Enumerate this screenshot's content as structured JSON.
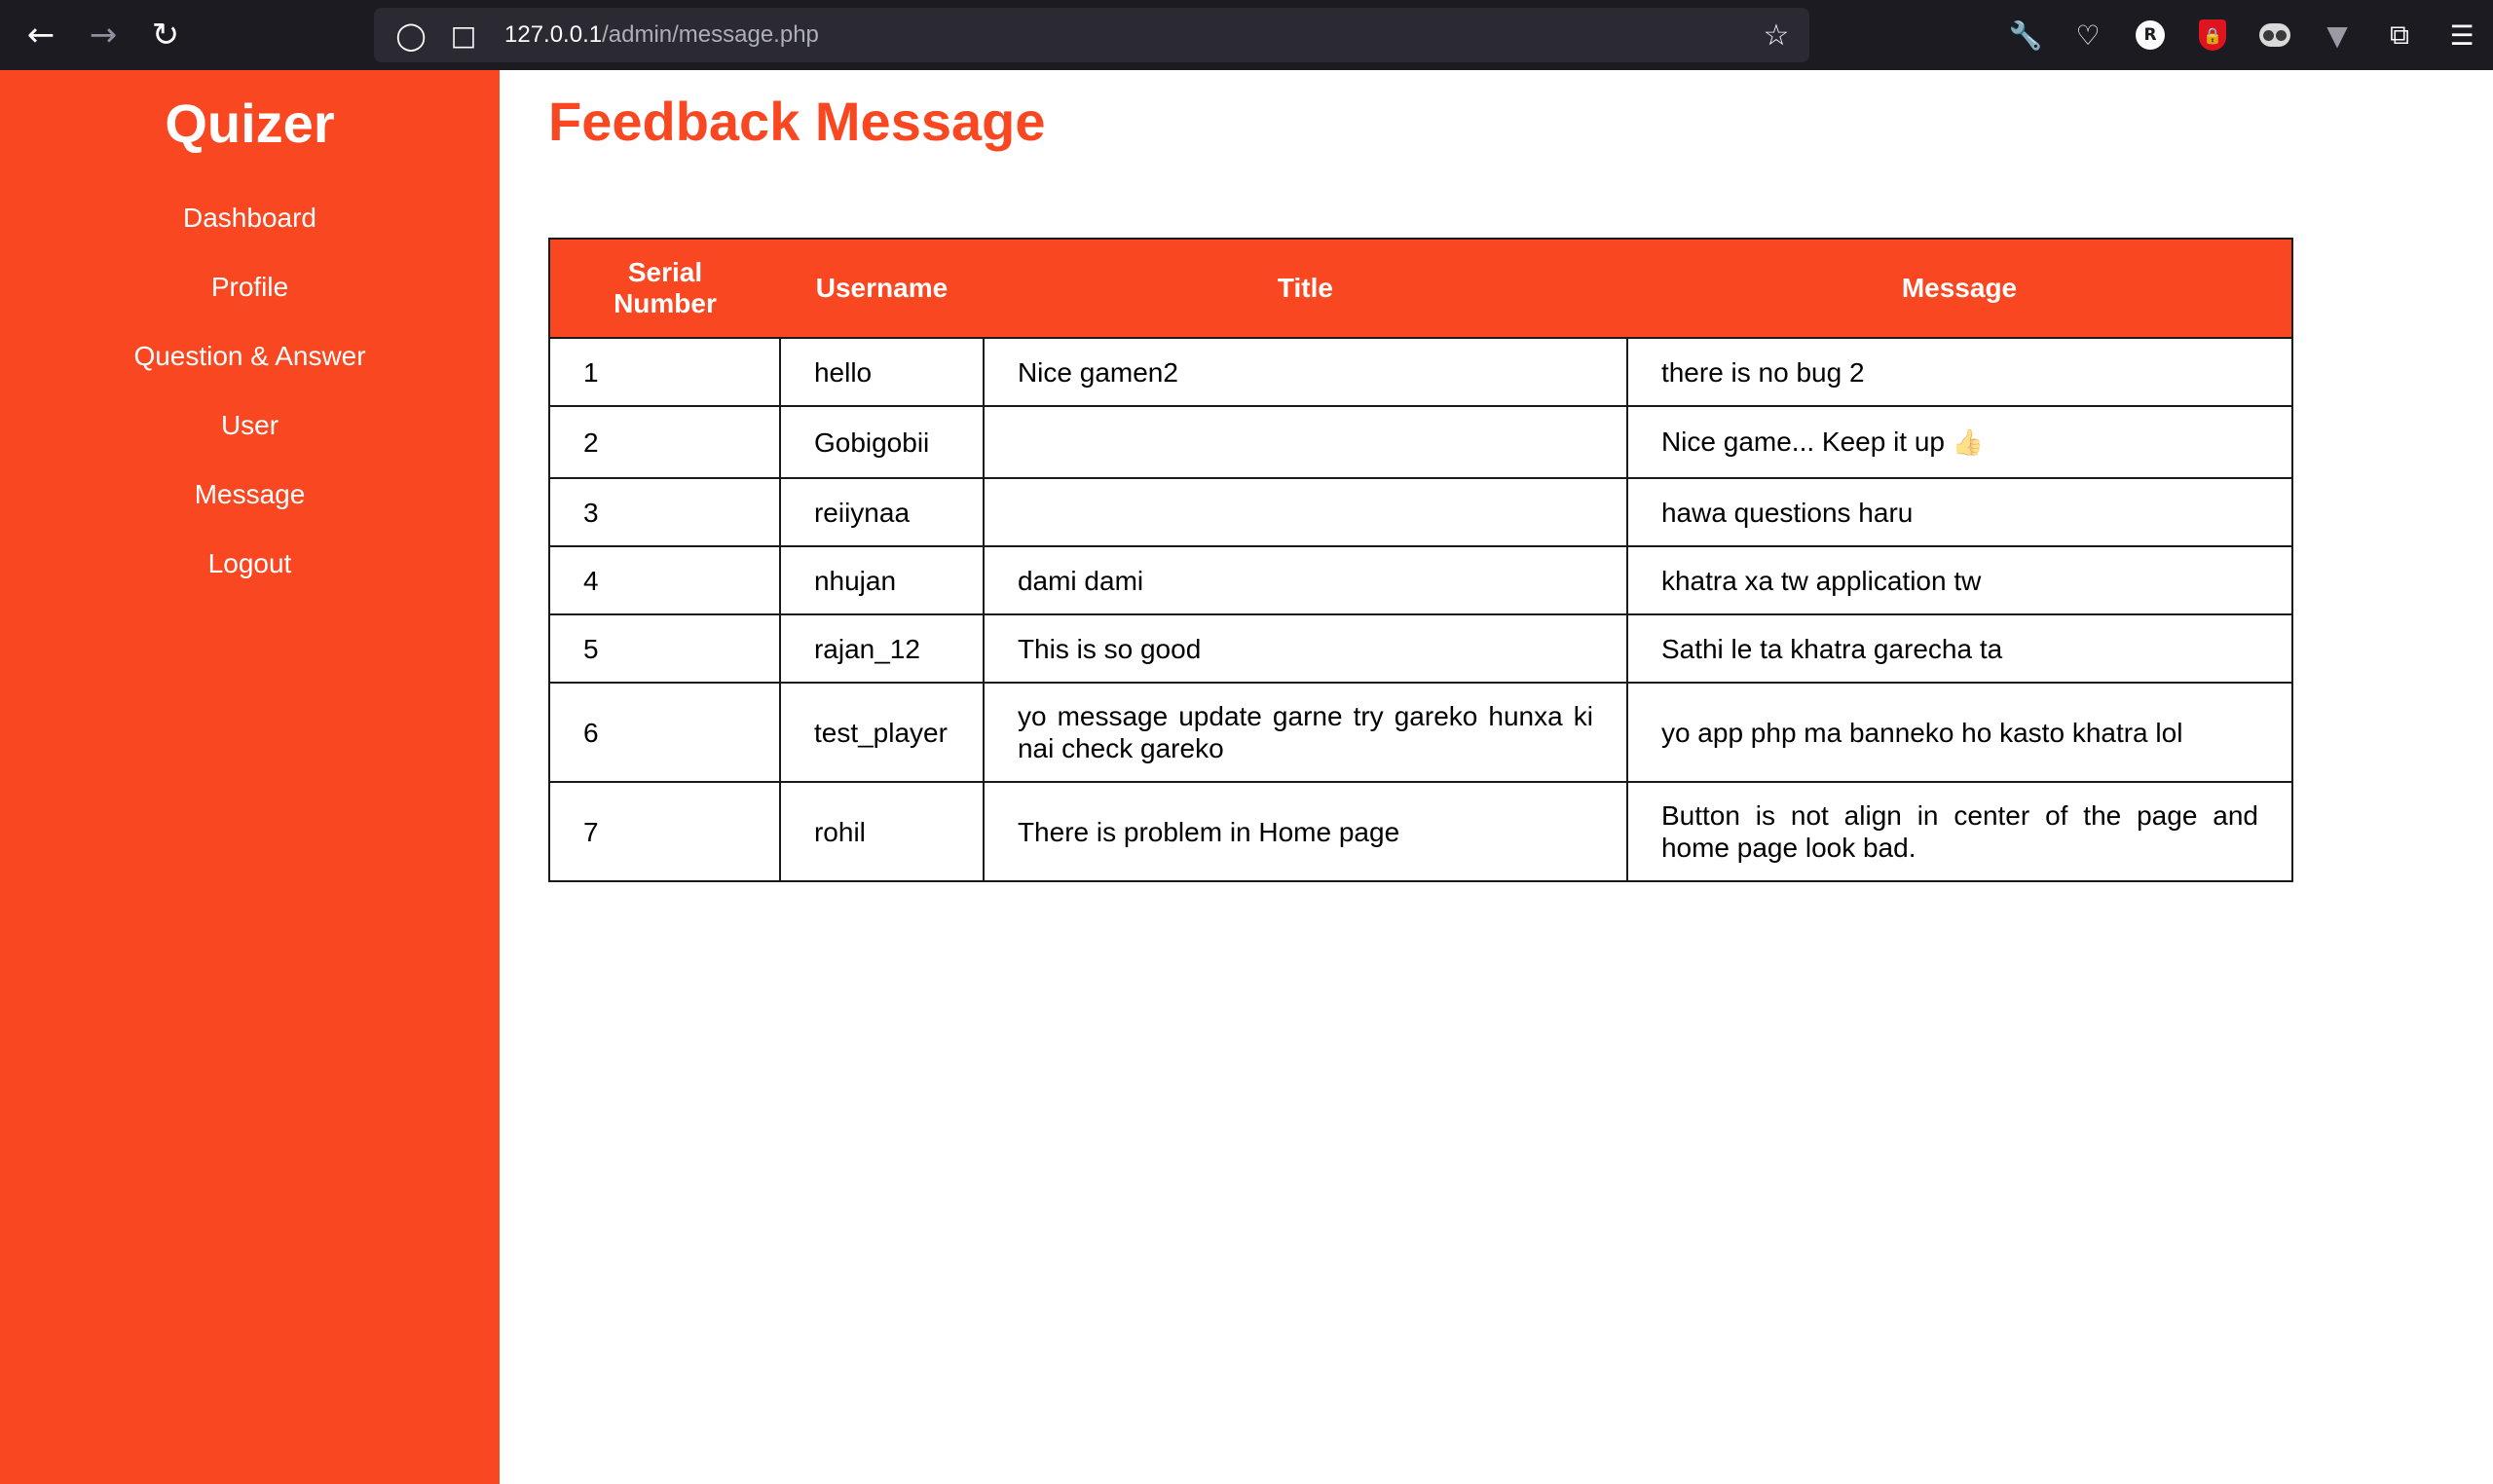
{
  "browser": {
    "url_host": "127.0.0.1",
    "url_path": "/admin/message.php",
    "extension_badge": "R"
  },
  "sidebar": {
    "brand": "Quizer",
    "items": [
      {
        "label": "Dashboard"
      },
      {
        "label": "Profile"
      },
      {
        "label": "Question & Answer"
      },
      {
        "label": "User"
      },
      {
        "label": "Message"
      },
      {
        "label": "Logout"
      }
    ]
  },
  "main": {
    "title": "Feedback Message",
    "table": {
      "headers": [
        "Serial Number",
        "Username",
        "Title",
        "Message"
      ],
      "rows": [
        {
          "serial": "1",
          "username": "hello",
          "title": "Nice gamen2",
          "message": "there is no bug 2"
        },
        {
          "serial": "2",
          "username": "Gobigobii",
          "title": "",
          "message": "Nice game... Keep it up",
          "message_emoji": "👍"
        },
        {
          "serial": "3",
          "username": "reiiynaa",
          "title": "",
          "message": "hawa questions haru"
        },
        {
          "serial": "4",
          "username": "nhujan",
          "title": "dami dami",
          "message": "khatra xa tw application tw"
        },
        {
          "serial": "5",
          "username": "rajan_12",
          "title": "This is so good",
          "message": "Sathi le ta khatra garecha ta"
        },
        {
          "serial": "6",
          "username": "test_player",
          "title": "yo message update garne try gareko hunxa ki nai check gareko",
          "message": "yo app php ma banneko ho kasto khatra lol"
        },
        {
          "serial": "7",
          "username": "rohil",
          "title": "There is problem in Home page",
          "message": "Button is not align in center of the page and home page look bad."
        }
      ]
    }
  },
  "colors": {
    "accent": "#f84721",
    "browser_bg": "#1c1b22"
  }
}
